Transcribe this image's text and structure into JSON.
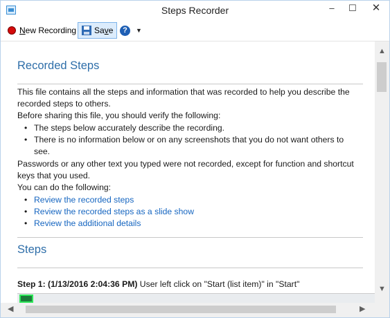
{
  "window": {
    "title": "Steps Recorder",
    "controls": {
      "minimize": "–",
      "maximize": "☐",
      "close": "✕"
    }
  },
  "toolbar": {
    "new_recording_prefix": "N",
    "new_recording_rest": "ew Recording",
    "save_prefix": "Sa",
    "save_underlined": "v",
    "save_rest": "e",
    "help_glyph": "?",
    "dropdown_glyph": "▼"
  },
  "report": {
    "heading": "Recorded Steps",
    "intro": "This file contains all the steps and information that was recorded to help you describe the recorded steps to others.",
    "verify_intro": "Before sharing this file, you should verify the following:",
    "verify_bullets": [
      "The steps below accurately describe the recording.",
      "There is no information below or on any screenshots that you do not want others to see."
    ],
    "passwords_note": "Passwords or any other text you typed were not recorded, except for function and shortcut keys that you used.",
    "can_do_intro": "You can do the following:",
    "links": [
      "Review the recorded steps",
      "Review the recorded steps as a slide show",
      "Review the additional details"
    ],
    "steps_heading": "Steps",
    "step1_label": "Step 1: (1/13/2016 2:04:36 PM)",
    "step1_text": " User left click on \"Start (list item)\" in \"Start\""
  },
  "scroll": {
    "up": "▲",
    "down": "▼",
    "left": "◀",
    "right": "▶"
  },
  "colors": {
    "heading": "#2e6ea9",
    "link": "#1565c0",
    "record": "#d40b0b"
  }
}
